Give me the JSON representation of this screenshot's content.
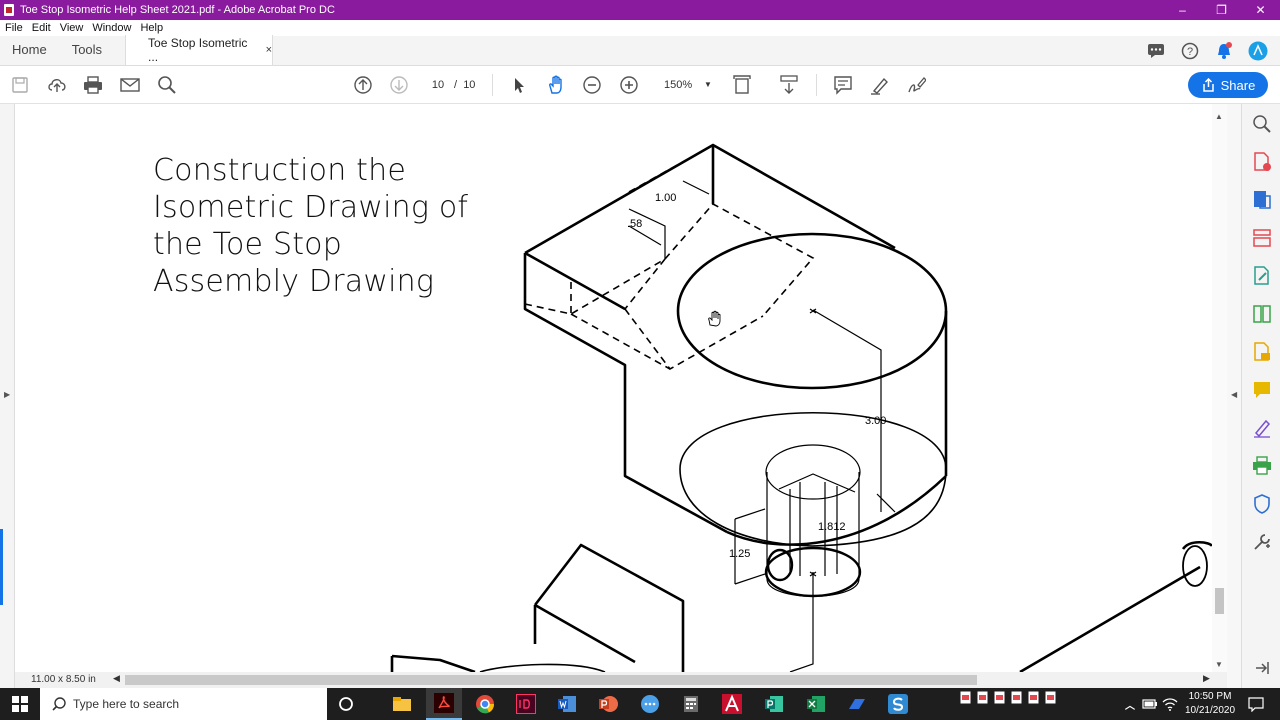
{
  "window": {
    "title": "Toe Stop Isometric Help Sheet 2021.pdf - Adobe Acrobat Pro DC",
    "minimize": "–",
    "maximize": "❐",
    "close": "✕"
  },
  "menu": [
    "File",
    "Edit",
    "View",
    "Window",
    "Help"
  ],
  "tabs": {
    "home": "Home",
    "tools": "Tools",
    "document": "Toe Stop Isometric ...",
    "close": "×"
  },
  "toolbar": {
    "page_current": "10",
    "page_sep": "/",
    "page_total": "10",
    "zoom": "150%",
    "share": "Share"
  },
  "document": {
    "heading_lines": [
      "Construction the",
      "Isometric Drawing of",
      "the Toe Stop",
      "Assembly Drawing"
    ],
    "dimensions": {
      "d1": "1.00",
      "d2": ".58",
      "d3": "3.00",
      "d4": "1.812",
      "d5": "1.25"
    }
  },
  "status": {
    "page_size": "11.00 x 8.50 in"
  },
  "taskbar": {
    "search_placeholder": "Type here to search",
    "time": "10:50 PM",
    "date": "10/21/2020"
  },
  "colors": {
    "title_bar": "#8a1a9e",
    "accent": "#1473e6",
    "taskbar": "#1e1e1e"
  }
}
